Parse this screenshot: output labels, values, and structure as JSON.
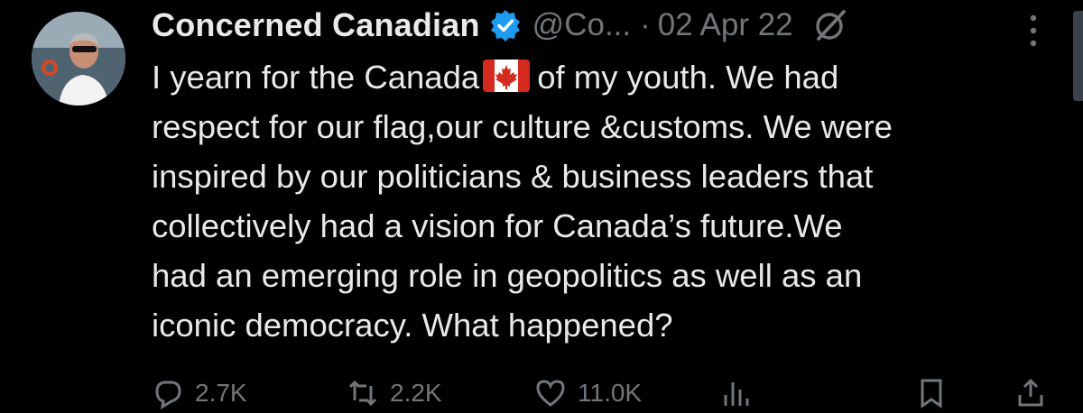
{
  "tweet": {
    "author": {
      "display_name": "Concerned Canadian",
      "handle": "@Co...",
      "verified": true,
      "verified_color": "#1d9bf0"
    },
    "separator": "·",
    "date": "02 Apr 22",
    "body_lines": [
      {
        "before": "I yearn for the Canada",
        "emoji": "canada-flag",
        "after": "of my youth. We had"
      },
      "respect for our flag,our culture &customs. We were",
      "inspired by our politicians & business leaders that",
      "collectively had a vision for Canada’s future.We",
      "had an emerging role in geopolitics as well as an",
      "iconic democracy. What happened?"
    ],
    "actions": [
      {
        "icon": "reply-icon",
        "count": "2.7K"
      },
      {
        "icon": "retweet-icon",
        "count": "2.2K"
      },
      {
        "icon": "like-icon",
        "count": "11.0K"
      },
      {
        "icon": "views-icon",
        "count": ""
      },
      {
        "icon": "bookmark-icon",
        "count": ""
      },
      {
        "icon": "share-icon",
        "count": ""
      }
    ]
  },
  "colors": {
    "background": "#000000",
    "primary_text": "#e7e9ea",
    "secondary_text": "#71767b",
    "flag_red": "#d52b1e"
  }
}
